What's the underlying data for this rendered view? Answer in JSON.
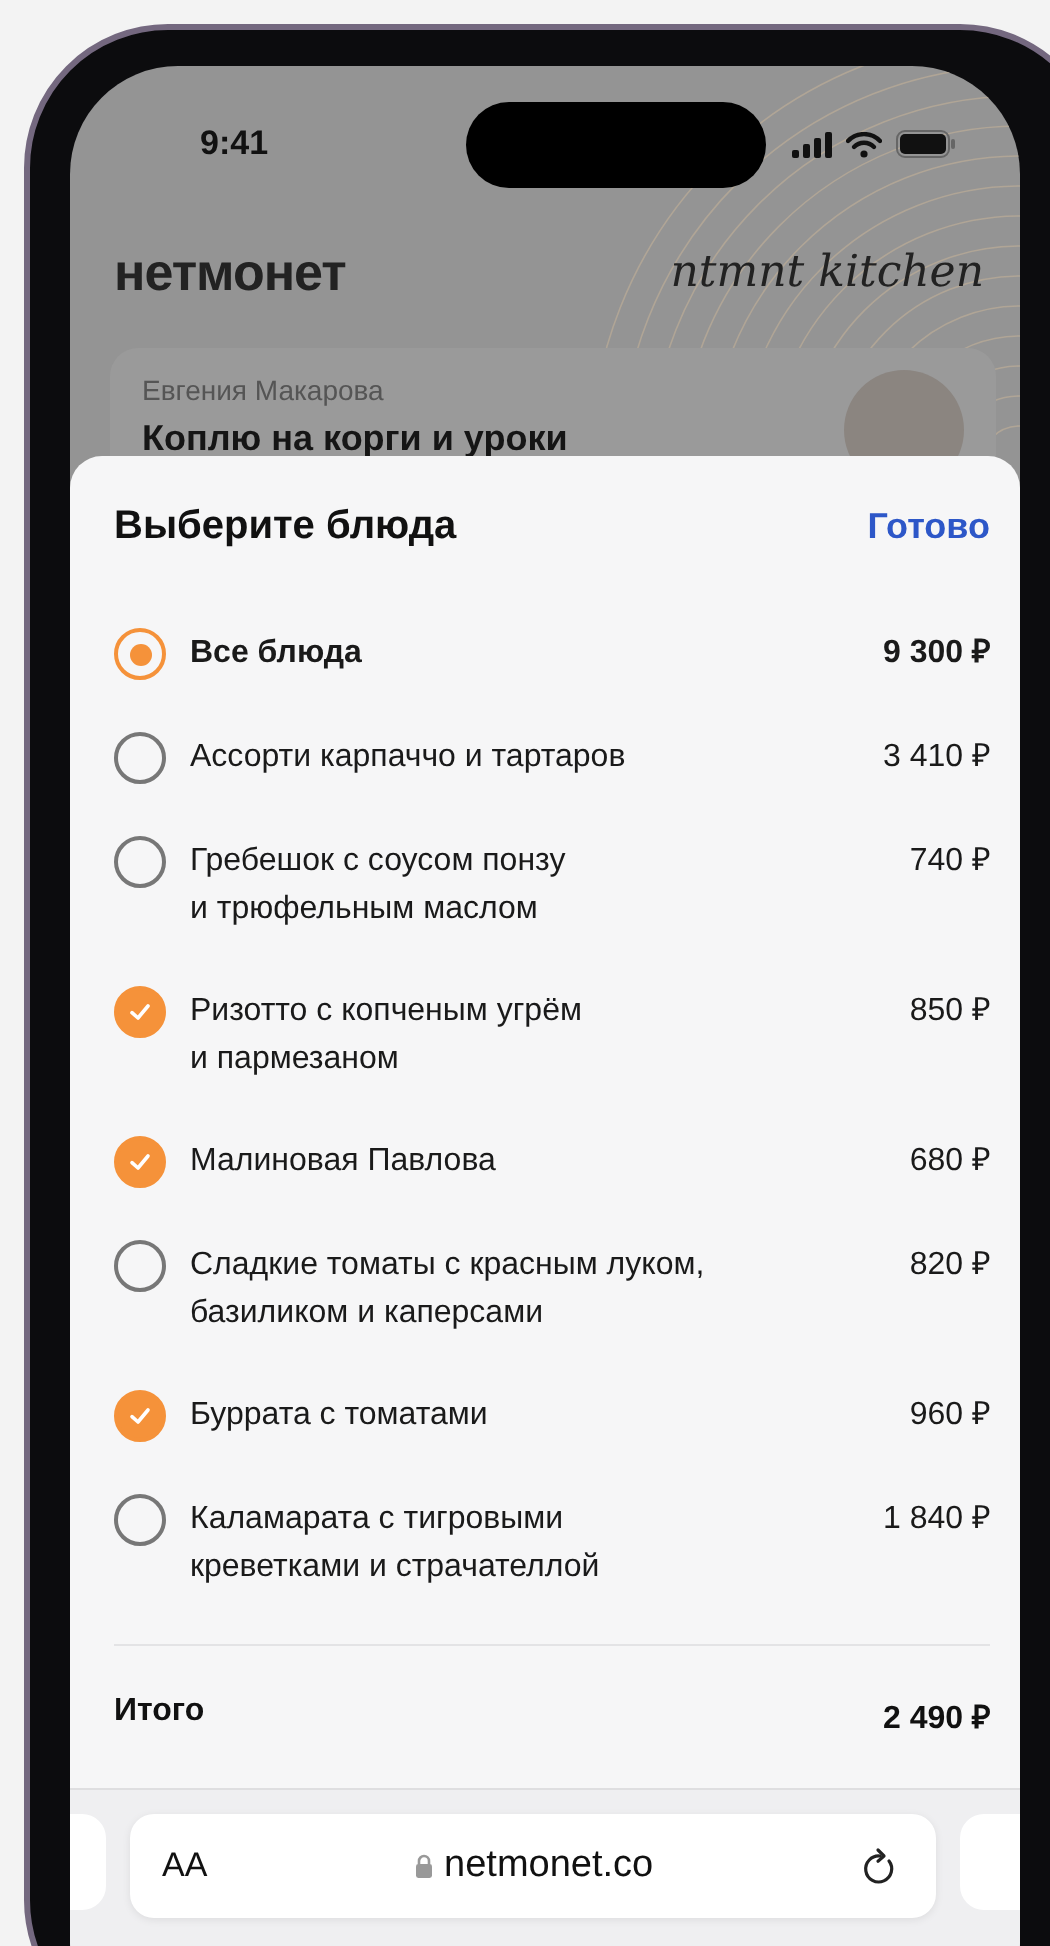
{
  "status_bar": {
    "time": "9:41"
  },
  "header": {
    "logo": "нетмонет",
    "tagline": "ntmnt kitchen"
  },
  "card": {
    "name": "Евгения Макарова",
    "title": "Коплю на корги и уроки"
  },
  "sheet": {
    "title": "Выберите блюда",
    "done": "Готово",
    "items": [
      {
        "kind": "all",
        "label": "Все блюда",
        "price": "9 300 ₽",
        "selected": true
      },
      {
        "kind": "dish",
        "label": "Ассорти карпаччо и тартаров",
        "price": "3 410 ₽",
        "checked": false
      },
      {
        "kind": "dish",
        "label": "Гребешок с соусом понзу\nи трюфельным маслом",
        "price": "740 ₽",
        "checked": false
      },
      {
        "kind": "dish",
        "label": "Ризотто с копченым угрём\nи пармезаном",
        "price": "850 ₽",
        "checked": true
      },
      {
        "kind": "dish",
        "label": "Малиновая Павлова",
        "price": "680 ₽",
        "checked": true
      },
      {
        "kind": "dish",
        "label": "Сладкие томаты с красным луком,\nбазиликом и каперсами",
        "price": "820 ₽",
        "checked": false
      },
      {
        "kind": "dish",
        "label": "Буррата с томатами",
        "price": "960 ₽",
        "checked": true
      },
      {
        "kind": "dish",
        "label": "Каламарата с тигровыми\nкреветками и страчателлой",
        "price": "1 840 ₽",
        "checked": false
      }
    ],
    "total": {
      "label": "Итого",
      "value": "2 490 ₽"
    }
  },
  "browser": {
    "text_size": "AA",
    "url": "netmonet.co"
  }
}
